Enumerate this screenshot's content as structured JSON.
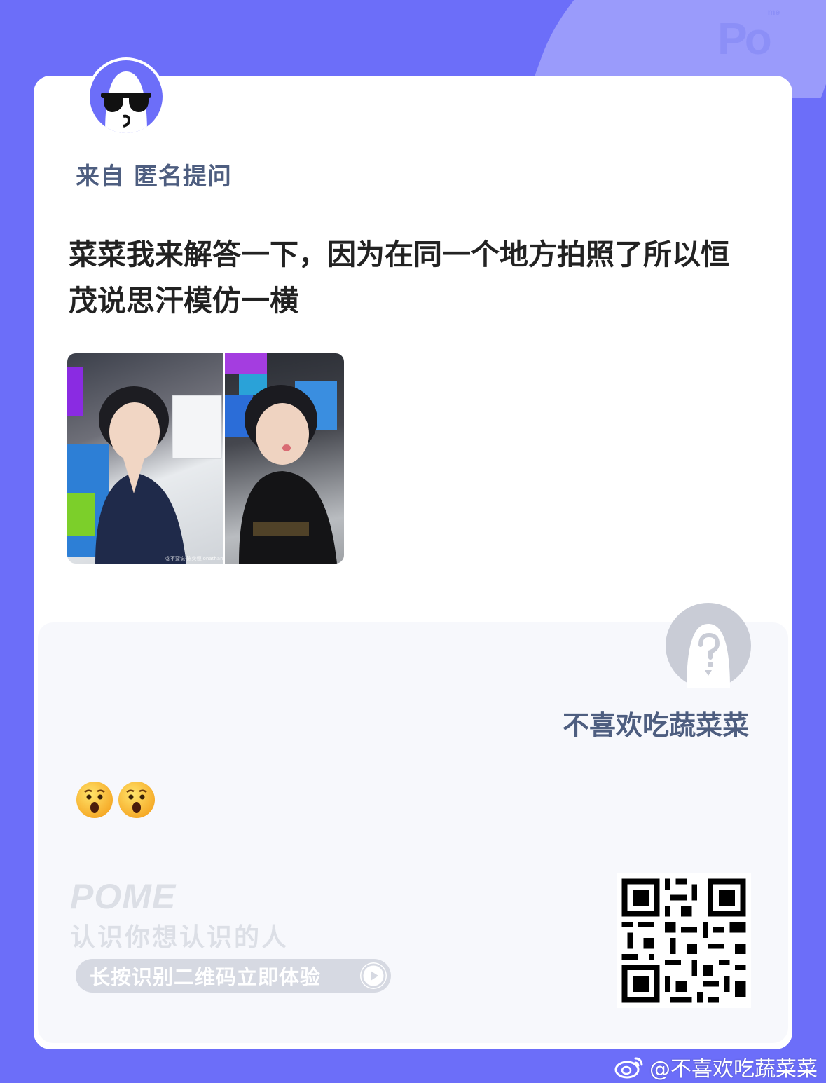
{
  "header": {
    "logo_text": "Po",
    "logo_sup": "me"
  },
  "question": {
    "from_label": "来自 匿名提问",
    "text": "菜菜我来解答一下，因为在同一个地方拍照了所以恒茂说思汗模仿一横",
    "photo_watermark": "@不要说-陈奕恒Jonathan"
  },
  "answer": {
    "answerer_name": "不喜欢吃蔬菜菜",
    "emojis": [
      "😲",
      "😲"
    ]
  },
  "footer": {
    "brand": "POME",
    "slogan": "认识你想认识的人",
    "cta_label": "长按识别二维码立即体验"
  },
  "watermark": {
    "text": "@不喜欢吃蔬菜菜"
  },
  "colors": {
    "background": "#6C6EF9",
    "card": "#FFFFFF",
    "answer_panel": "#F7F8FC",
    "label": "#4E5E80"
  },
  "icons": [
    "po-logo-icon",
    "sunglasses-avatar-icon",
    "question-avatar-icon",
    "play-icon",
    "qr-code-icon",
    "weibo-icon"
  ]
}
